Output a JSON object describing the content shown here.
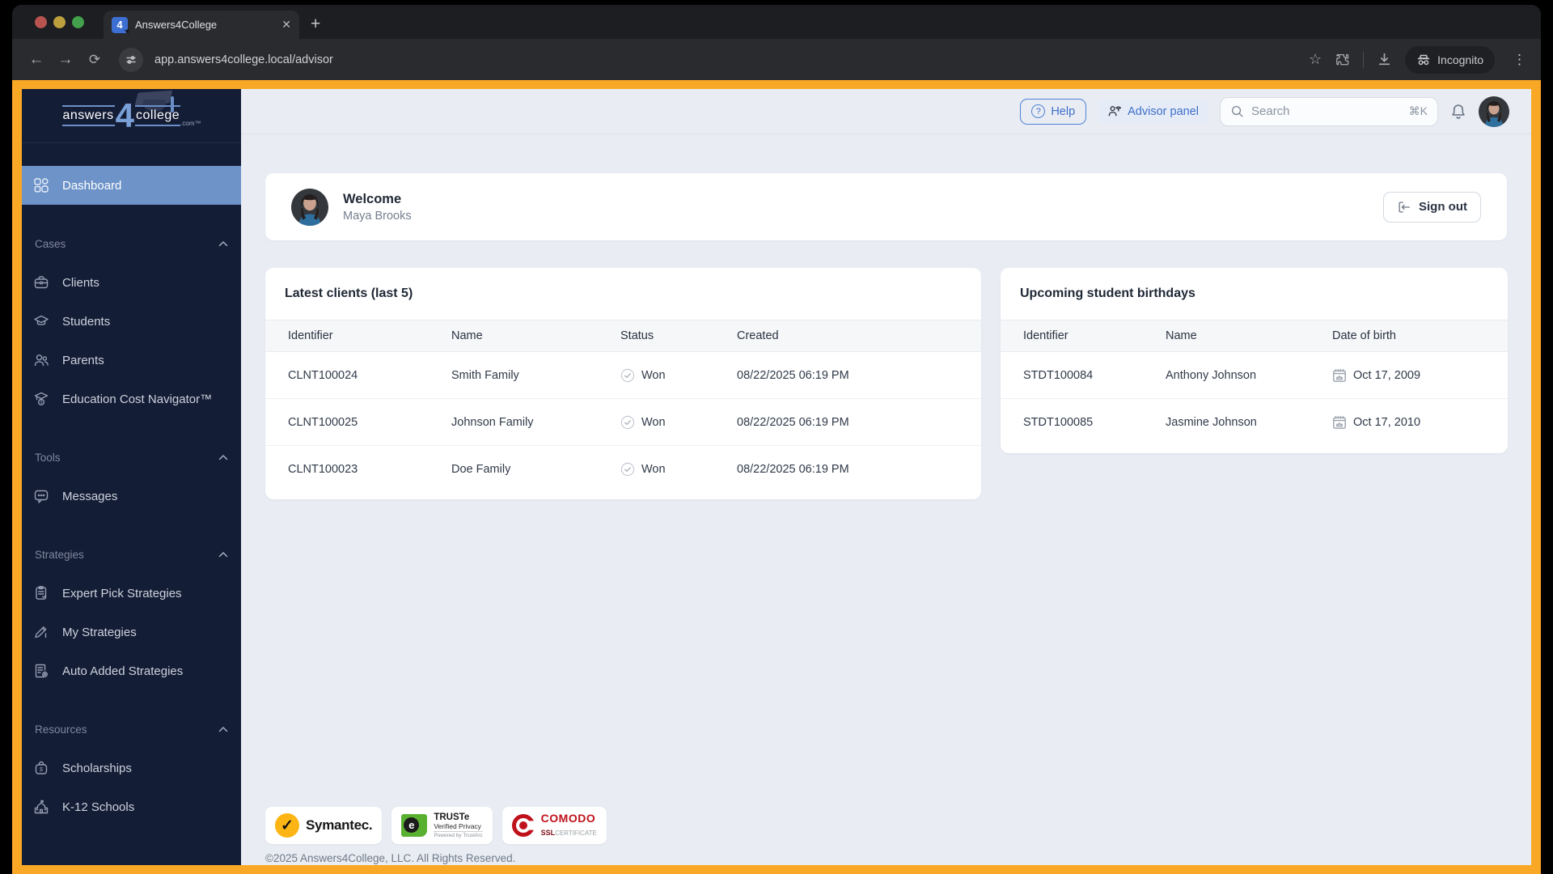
{
  "browser": {
    "tab_title": "Answers4College",
    "favicon_text": "4",
    "url": "app.answers4college.local/advisor",
    "incognito_label": "Incognito"
  },
  "sidebar": {
    "logo": {
      "part1": "answers",
      "part2": "4",
      "part3": "college",
      "suffix": ".com™"
    },
    "dashboard": {
      "label": "Dashboard",
      "icon": "dashboard-grid"
    },
    "sections": [
      {
        "label": "Cases",
        "items": [
          {
            "label": "Clients",
            "icon": "briefcase"
          },
          {
            "label": "Students",
            "icon": "graduation-cap"
          },
          {
            "label": "Parents",
            "icon": "people"
          },
          {
            "label": "Education Cost Navigator™",
            "icon": "cap-dollar"
          }
        ]
      },
      {
        "label": "Tools",
        "items": [
          {
            "label": "Messages",
            "icon": "chat-bubble"
          }
        ]
      },
      {
        "label": "Strategies",
        "items": [
          {
            "label": "Expert Pick Strategies",
            "icon": "clipboard-check"
          },
          {
            "label": "My Strategies",
            "icon": "pen"
          },
          {
            "label": "Auto Added Strategies",
            "icon": "document-gear"
          }
        ]
      },
      {
        "label": "Resources",
        "items": [
          {
            "label": "Scholarships",
            "icon": "money-bag"
          },
          {
            "label": "K-12 Schools",
            "icon": "school-building"
          }
        ]
      }
    ]
  },
  "header": {
    "help_label": "Help",
    "advisor_panel_label": "Advisor panel",
    "search_placeholder": "Search",
    "search_shortcut": "⌘K"
  },
  "welcome": {
    "title": "Welcome",
    "user_name": "Maya Brooks",
    "sign_out_label": "Sign out"
  },
  "latest_clients": {
    "title": "Latest clients (last 5)",
    "columns": [
      "Identifier",
      "Name",
      "Status",
      "Created"
    ],
    "rows": [
      {
        "identifier": "CLNT100024",
        "name": "Smith Family",
        "status": "Won",
        "created": "08/22/2025 06:19 PM"
      },
      {
        "identifier": "CLNT100025",
        "name": "Johnson Family",
        "status": "Won",
        "created": "08/22/2025 06:19 PM"
      },
      {
        "identifier": "CLNT100023",
        "name": "Doe Family",
        "status": "Won",
        "created": "08/22/2025 06:19 PM"
      }
    ]
  },
  "birthdays": {
    "title": "Upcoming student birthdays",
    "columns": [
      "Identifier",
      "Name",
      "Date of birth"
    ],
    "rows": [
      {
        "identifier": "STDT100084",
        "name": "Anthony Johnson",
        "dob": "Oct 17, 2009"
      },
      {
        "identifier": "STDT100085",
        "name": "Jasmine Johnson",
        "dob": "Oct 17, 2010"
      }
    ]
  },
  "footer": {
    "symantec_label": "Symantec.",
    "truste_line1": "TRUSTe",
    "truste_line2": "Verified Privacy",
    "truste_line3": "Powered by TrustArc",
    "comodo_line1": "COMODO",
    "comodo_ssl": "SSL",
    "comodo_cert": "CERTIFICATE",
    "copyright": "©2025 Answers4College, LLC. All Rights Reserved."
  },
  "colors": {
    "capture_border": "#f9a826",
    "sidebar_bg": "#141d36",
    "active_item_bg": "#6d93c8",
    "link_blue": "#3d6fc9",
    "page_bg": "#e9ecf3"
  }
}
